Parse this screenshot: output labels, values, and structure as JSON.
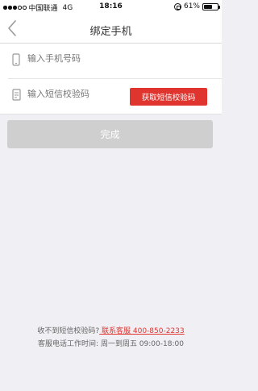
{
  "status_bar": {
    "carrier": "中国联通",
    "network": "4G",
    "time": "18:16",
    "battery": "61%",
    "battery_level": 0.61
  },
  "nav": {
    "title": "绑定手机"
  },
  "form": {
    "phone_placeholder": "输入手机号码",
    "code_placeholder": "输入短信校验码",
    "send_code_label": "获取短信校验码"
  },
  "actions": {
    "done_label": "完成"
  },
  "footer": {
    "prompt": "收不到短信校验码?",
    "contact_link": " 联系客服 400-850-2233",
    "hours": "客服电话工作时间: 周一到周五 09:00-18:00"
  },
  "colors": {
    "accent": "#e0342f",
    "disabled_button": "#cfcfcf",
    "background": "#efeff4"
  }
}
